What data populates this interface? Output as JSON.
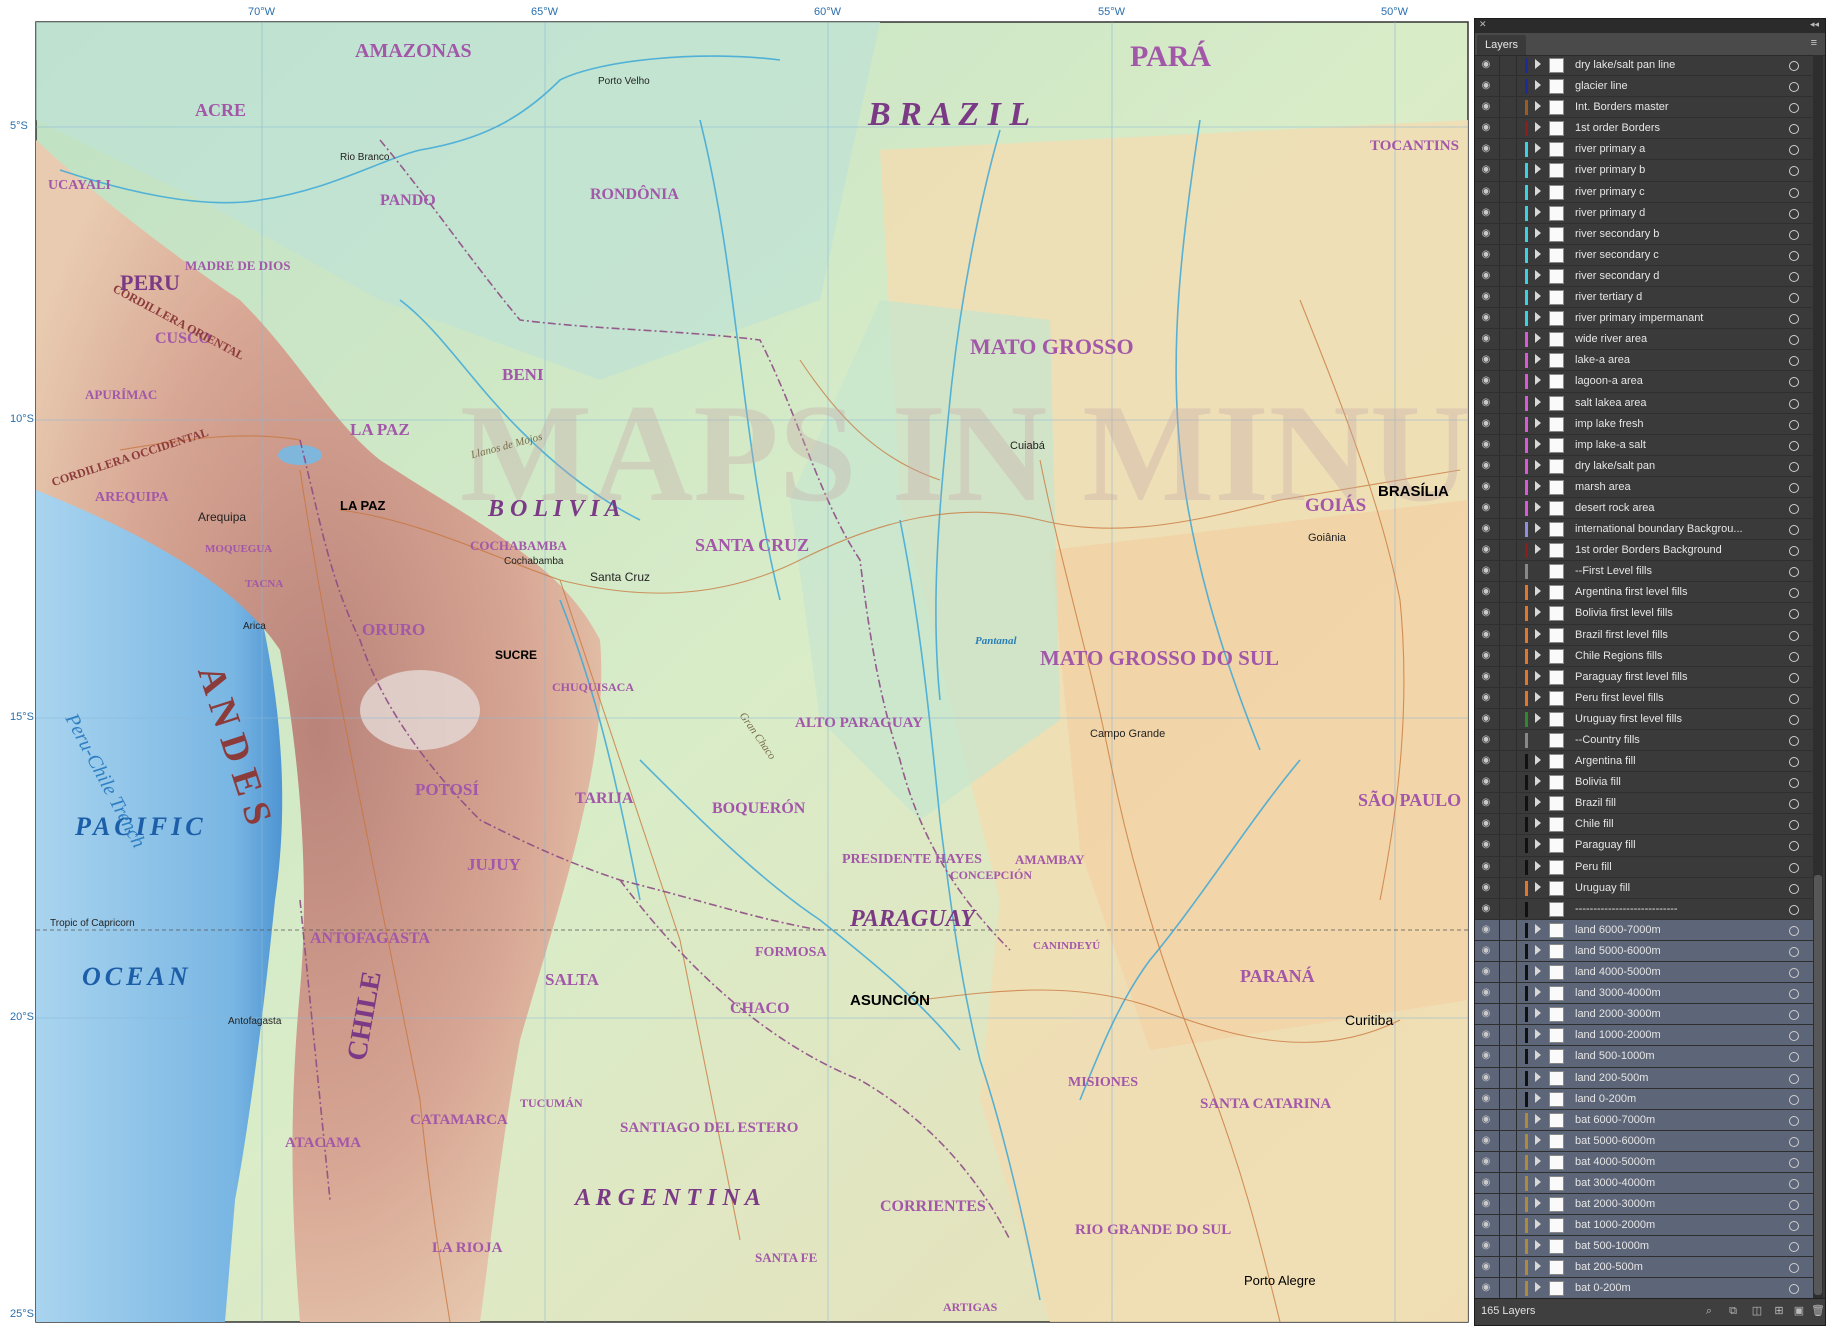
{
  "map": {
    "longitudes": [
      "70°W",
      "65°W",
      "60°W",
      "55°W",
      "50°W"
    ],
    "latitudes": [
      "5°S",
      "10°S",
      "15°S",
      "20°S",
      "25°S"
    ],
    "countries": [
      "BRAZIL",
      "PERU",
      "BOLIVIA",
      "PARAGUAY",
      "ARGENTINA",
      "CHILE"
    ],
    "regions": [
      "AMAZONAS",
      "PARÁ",
      "ACRE",
      "PANDO",
      "RONDÔNIA",
      "TOCANTINS",
      "MATO GROSSO",
      "BENI",
      "SANTA CRUZ",
      "GOIÁS",
      "MATO GROSSO DO SUL",
      "CUSCO",
      "APURÍMAC",
      "AREQUIPA",
      "LA PAZ",
      "ORURO",
      "COCHABAMBA",
      "POTOSÍ",
      "CHUQUISACA",
      "TARIJA",
      "JUJUY",
      "SALTA",
      "ANTOFAGASTA",
      "ATACAMA",
      "CATAMARCA",
      "LA RIOJA",
      "TUCUMÁN",
      "SANTIAGO DEL ESTERO",
      "CHACO",
      "FORMOSA",
      "CORRIENTES",
      "MISIONES",
      "BOQUERÓN",
      "ALTO PARAGUAY",
      "PRESIDENTE HAYES",
      "CONCEPCIÓN",
      "AMAMBAY",
      "CANINDEYÚ",
      "SÃO PAULO",
      "PARANÁ",
      "SANTA CATARINA",
      "RIO GRANDE DO SUL",
      "SANTA FE",
      "ARTIGAS",
      "MADRE DE DIOS",
      "UCAYALI",
      "TACNA",
      "MOQUEGUA"
    ],
    "physical": [
      "PACIFIC",
      "OCEAN",
      "Peru-Chile Trench",
      "ANDES",
      "CORDILLERA OCCIDENTAL",
      "CORDILLERA ORIENTAL",
      "Tropic of Capricorn",
      "Llanos de Mojos",
      "Pantanal",
      "Gran Chaco"
    ],
    "cities": [
      "LA PAZ",
      "SUCRE",
      "ASUNCIÓN",
      "BRASÍLIA",
      "Arequipa",
      "Santa Cruz",
      "Curitiba",
      "Porto Alegre",
      "Campo Grande",
      "Cuiabá",
      "Goiânia",
      "Cochabamba",
      "Antofagasta",
      "Arica",
      "Porto Velho",
      "Rio Branco"
    ],
    "watermark": "MAPS IN MINUTES ©"
  },
  "panel": {
    "title": "Layers",
    "close_glyph": "✕",
    "collapse_glyph": "◂◂",
    "menu_glyph": "≡",
    "layer_count": "165 Layers",
    "layers": [
      {
        "label": "dry lake/salt pan line",
        "color": "#1f2a9c",
        "sel": false,
        "tri": true
      },
      {
        "label": "glacier line",
        "color": "#1f2a9c",
        "sel": false,
        "tri": true
      },
      {
        "label": "Int. Borders master",
        "color": "#9c5a24",
        "sel": false,
        "tri": true
      },
      {
        "label": "1st order Borders",
        "color": "#8a1e1e",
        "sel": false,
        "tri": true
      },
      {
        "label": "river primary a",
        "color": "#3ad2e0",
        "sel": false,
        "tri": true
      },
      {
        "label": "river primary b",
        "color": "#3ad2e0",
        "sel": false,
        "tri": true
      },
      {
        "label": "river primary c",
        "color": "#3ad2e0",
        "sel": false,
        "tri": true
      },
      {
        "label": "river primary d",
        "color": "#3ad2e0",
        "sel": false,
        "tri": true
      },
      {
        "label": "river secondary b",
        "color": "#3ad2e0",
        "sel": false,
        "tri": true
      },
      {
        "label": "river secondary c",
        "color": "#3ad2e0",
        "sel": false,
        "tri": true
      },
      {
        "label": "river secondary d",
        "color": "#3ad2e0",
        "sel": false,
        "tri": true
      },
      {
        "label": "river tertiary d",
        "color": "#3ad2e0",
        "sel": false,
        "tri": true
      },
      {
        "label": "river primary impermanant",
        "color": "#3ad2e0",
        "sel": false,
        "tri": true
      },
      {
        "label": "wide river area",
        "color": "#d85ad8",
        "sel": false,
        "tri": true
      },
      {
        "label": "lake-a area",
        "color": "#d85ad8",
        "sel": false,
        "tri": true
      },
      {
        "label": "lagoon-a area",
        "color": "#d85ad8",
        "sel": false,
        "tri": true
      },
      {
        "label": "salt lakea area",
        "color": "#d85ad8",
        "sel": false,
        "tri": true
      },
      {
        "label": "imp lake fresh",
        "color": "#d85ad8",
        "sel": false,
        "tri": true
      },
      {
        "label": "imp lake-a salt",
        "color": "#d85ad8",
        "sel": false,
        "tri": true
      },
      {
        "label": "dry lake/salt pan",
        "color": "#d85ad8",
        "sel": false,
        "tri": true
      },
      {
        "label": "marsh area",
        "color": "#d85ad8",
        "sel": false,
        "tri": true
      },
      {
        "label": "desert rock area",
        "color": "#d85ad8",
        "sel": false,
        "tri": true
      },
      {
        "label": "international boundary Backgrou...",
        "color": "#8f8fe0",
        "sel": false,
        "tri": true
      },
      {
        "label": "1st order Borders Background",
        "color": "#8a1e1e",
        "sel": false,
        "tri": true
      },
      {
        "label": "--First Level fills",
        "color": "#888888",
        "sel": false,
        "tri": false
      },
      {
        "label": "Argentina first level fills",
        "color": "#e2762a",
        "sel": false,
        "tri": true
      },
      {
        "label": "Bolivia first level fills",
        "color": "#e2762a",
        "sel": false,
        "tri": true
      },
      {
        "label": "Brazil first level fills",
        "color": "#e2762a",
        "sel": false,
        "tri": true
      },
      {
        "label": "Chile Regions fills",
        "color": "#e2762a",
        "sel": false,
        "tri": true
      },
      {
        "label": "Paraguay first level fills",
        "color": "#e2762a",
        "sel": false,
        "tri": true
      },
      {
        "label": "Peru first level fills",
        "color": "#e2762a",
        "sel": false,
        "tri": true
      },
      {
        "label": "Uruguay first level fills",
        "color": "#2c8a2c",
        "sel": false,
        "tri": true
      },
      {
        "label": "--Country fills",
        "color": "#888888",
        "sel": false,
        "tri": false
      },
      {
        "label": "Argentina fill",
        "color": "#111111",
        "sel": false,
        "tri": true
      },
      {
        "label": "Bolivia fill",
        "color": "#111111",
        "sel": false,
        "tri": true
      },
      {
        "label": "Brazil fill",
        "color": "#111111",
        "sel": false,
        "tri": true
      },
      {
        "label": "Chile fill",
        "color": "#111111",
        "sel": false,
        "tri": true
      },
      {
        "label": "Paraguay fill",
        "color": "#111111",
        "sel": false,
        "tri": true
      },
      {
        "label": "Peru fill",
        "color": "#111111",
        "sel": false,
        "tri": true
      },
      {
        "label": "Uruguay fill",
        "color": "#e2762a",
        "sel": false,
        "tri": true
      },
      {
        "label": "----------------------------",
        "color": "#111111",
        "sel": false,
        "tri": false
      },
      {
        "label": "land 6000-7000m",
        "color": "#111111",
        "sel": true,
        "tri": true
      },
      {
        "label": "land 5000-6000m",
        "color": "#111111",
        "sel": true,
        "tri": true
      },
      {
        "label": "land 4000-5000m",
        "color": "#111111",
        "sel": true,
        "tri": true
      },
      {
        "label": "land 3000-4000m",
        "color": "#111111",
        "sel": true,
        "tri": true
      },
      {
        "label": "land 2000-3000m",
        "color": "#111111",
        "sel": true,
        "tri": true
      },
      {
        "label": "land 1000-2000m",
        "color": "#111111",
        "sel": true,
        "tri": true
      },
      {
        "label": "land 500-1000m",
        "color": "#111111",
        "sel": true,
        "tri": true
      },
      {
        "label": "land 200-500m",
        "color": "#111111",
        "sel": true,
        "tri": true
      },
      {
        "label": "land 0-200m",
        "color": "#111111",
        "sel": true,
        "tri": true
      },
      {
        "label": "bat 6000-7000m",
        "color": "#b08a3a",
        "sel": true,
        "tri": true
      },
      {
        "label": "bat 5000-6000m",
        "color": "#b08a3a",
        "sel": true,
        "tri": true
      },
      {
        "label": "bat 4000-5000m",
        "color": "#b08a3a",
        "sel": true,
        "tri": true
      },
      {
        "label": "bat 3000-4000m",
        "color": "#b08a3a",
        "sel": true,
        "tri": true
      },
      {
        "label": "bat 2000-3000m",
        "color": "#b08a3a",
        "sel": true,
        "tri": true
      },
      {
        "label": "bat 1000-2000m",
        "color": "#b08a3a",
        "sel": true,
        "tri": true
      },
      {
        "label": "bat 500-1000m",
        "color": "#b08a3a",
        "sel": true,
        "tri": true
      },
      {
        "label": "bat 200-500m",
        "color": "#b08a3a",
        "sel": true,
        "tri": true
      },
      {
        "label": "bat 0-200m",
        "color": "#b08a3a",
        "sel": true,
        "tri": true
      }
    ],
    "footer_icons": [
      "search-icon",
      "collect-icon",
      "clip-icon",
      "new-sublayer-icon",
      "new-layer-icon",
      "trash-icon"
    ]
  }
}
